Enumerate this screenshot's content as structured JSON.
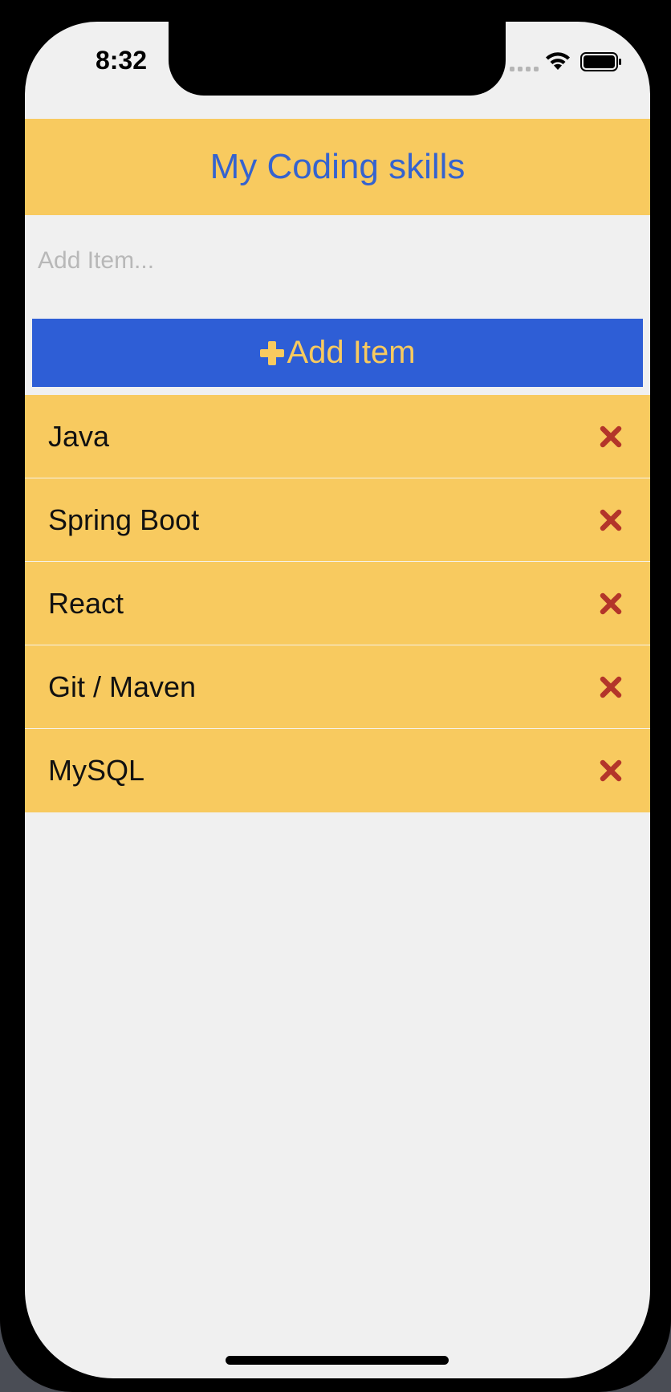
{
  "status_bar": {
    "time": "8:32"
  },
  "header": {
    "title": "My Coding skills"
  },
  "input": {
    "value": "",
    "placeholder": "Add Item..."
  },
  "add_button": {
    "label": "Add Item",
    "icon": "plus-icon"
  },
  "items": [
    {
      "label": "Java",
      "icon": "close-icon"
    },
    {
      "label": "Spring Boot",
      "icon": "close-icon"
    },
    {
      "label": "React",
      "icon": "close-icon"
    },
    {
      "label": "Git / Maven",
      "icon": "close-icon"
    },
    {
      "label": "MySQL",
      "icon": "close-icon"
    }
  ],
  "colors": {
    "header_bg": "#f8ca5f",
    "title_color": "#3563cf",
    "button_bg": "#2e5ed6",
    "button_text": "#f8ca5f",
    "delete_icon": "#b3352a",
    "screen_bg": "#f0f0f0"
  }
}
